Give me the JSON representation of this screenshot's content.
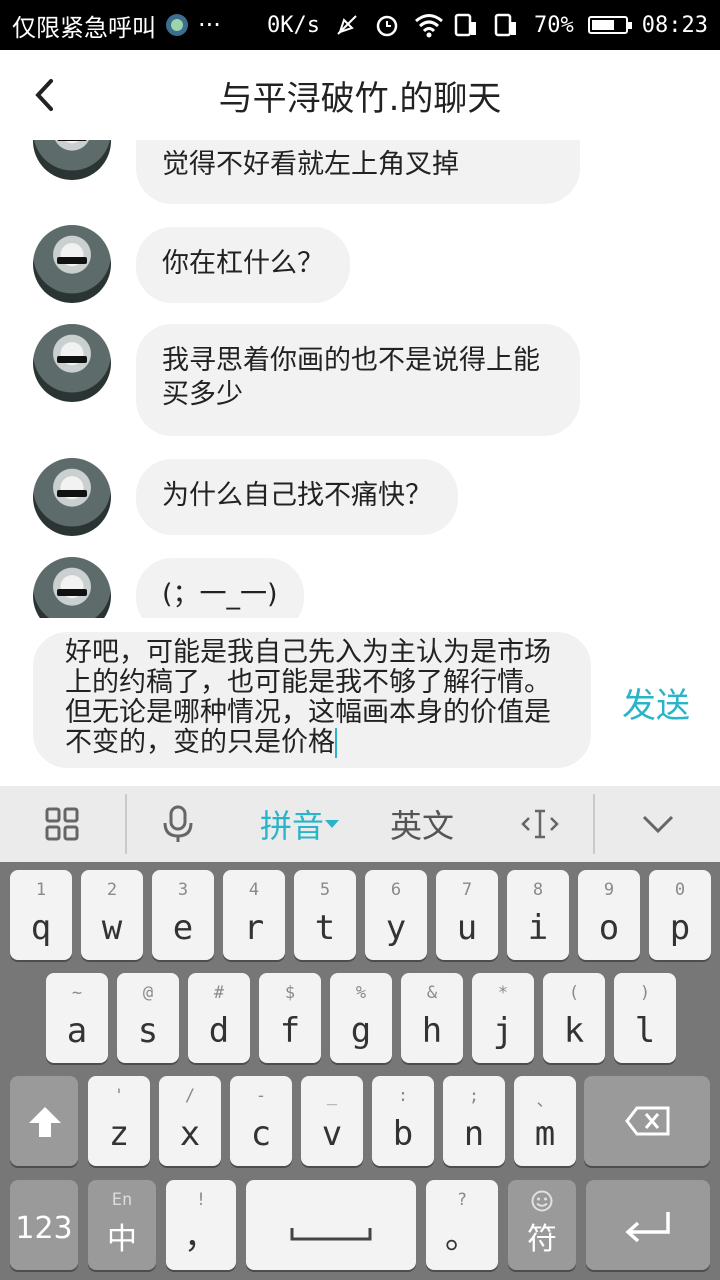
{
  "status_bar": {
    "carrier": "仅限紧急呼叫",
    "more": "···",
    "net_speed": "0K/s",
    "battery_percent": "70%",
    "battery_level": 0.7,
    "time": "08:23"
  },
  "header": {
    "title": "与平浔破竹.的聊天"
  },
  "messages": [
    {
      "text": "觉得不好看就左上角叉掉"
    },
    {
      "text": "你在杠什么？"
    },
    {
      "text": "我寻思着你画的也不是说得上能买多少"
    },
    {
      "text": "为什么自己找不痛快？"
    },
    {
      "text": "(；一_一)"
    }
  ],
  "composer": {
    "text": "好吧，可能是我自己先入为主认为是市场上的约稿了，也可能是我不够了解行情。但无论是哪种情况，这幅画本身的价值是不变的，变的只是价格",
    "send_label": "发送"
  },
  "ime_toolbar": {
    "pinyin_label": "拼音",
    "english_label": "英文"
  },
  "keyboard": {
    "row1": [
      {
        "hint": "1",
        "key": "q"
      },
      {
        "hint": "2",
        "key": "w"
      },
      {
        "hint": "3",
        "key": "e"
      },
      {
        "hint": "4",
        "key": "r"
      },
      {
        "hint": "5",
        "key": "t"
      },
      {
        "hint": "6",
        "key": "y"
      },
      {
        "hint": "7",
        "key": "u"
      },
      {
        "hint": "8",
        "key": "i"
      },
      {
        "hint": "9",
        "key": "o"
      },
      {
        "hint": "0",
        "key": "p"
      }
    ],
    "row2": [
      {
        "hint": "~",
        "key": "a"
      },
      {
        "hint": "@",
        "key": "s"
      },
      {
        "hint": "#",
        "key": "d"
      },
      {
        "hint": "$",
        "key": "f"
      },
      {
        "hint": "%",
        "key": "g"
      },
      {
        "hint": "&",
        "key": "h"
      },
      {
        "hint": "*",
        "key": "j"
      },
      {
        "hint": "(",
        "key": "k"
      },
      {
        "hint": ")",
        "key": "l"
      }
    ],
    "row3": [
      {
        "hint": "'",
        "key": "z"
      },
      {
        "hint": "/",
        "key": "x"
      },
      {
        "hint": "-",
        "key": "c"
      },
      {
        "hint": "_",
        "key": "v"
      },
      {
        "hint": ":",
        "key": "b"
      },
      {
        "hint": ";",
        "key": "n"
      },
      {
        "hint": "、",
        "key": "m"
      }
    ],
    "num_label": "123",
    "lang_hint": "En",
    "lang_label": "中",
    "comma_hint": "!",
    "comma_label": "，",
    "period_hint": "?",
    "period_label": "。",
    "symbol_label": "符"
  }
}
